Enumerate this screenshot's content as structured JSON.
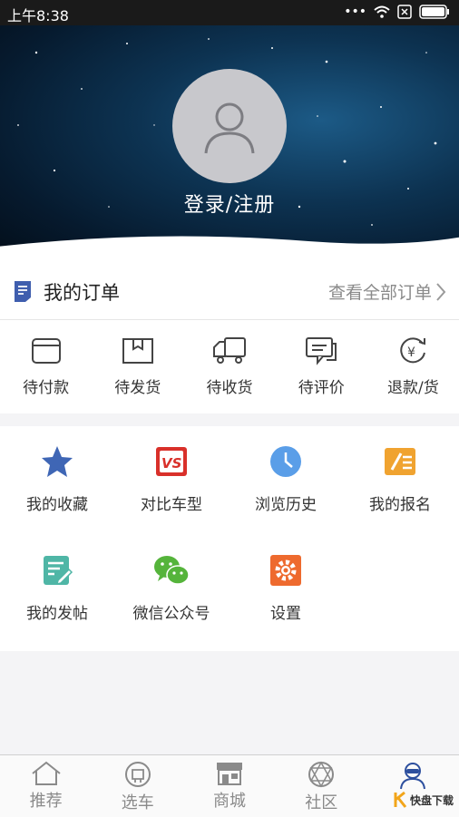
{
  "status_bar": {
    "time": "上午8:38"
  },
  "profile": {
    "login_label": "登录/注册"
  },
  "orders": {
    "title": "我的订单",
    "view_all": "查看全部订单",
    "items": [
      {
        "label": "待付款",
        "icon": "wallet-icon"
      },
      {
        "label": "待发货",
        "icon": "package-icon"
      },
      {
        "label": "待收货",
        "icon": "truck-icon"
      },
      {
        "label": "待评价",
        "icon": "comment-icon"
      },
      {
        "label": "退款/货",
        "icon": "refund-icon"
      }
    ]
  },
  "shortcuts": [
    {
      "label": "我的收藏",
      "icon": "star-icon",
      "color": "#3f66b5"
    },
    {
      "label": "对比车型",
      "icon": "vs-icon",
      "color": "#d9302a"
    },
    {
      "label": "浏览历史",
      "icon": "clock-icon",
      "color": "#5a9ee8"
    },
    {
      "label": "我的报名",
      "icon": "signup-icon",
      "color": "#f0a330"
    },
    {
      "label": "我的发帖",
      "icon": "post-icon",
      "color": "#4fb6a6"
    },
    {
      "label": "微信公众号",
      "icon": "wechat-icon",
      "color": "#55b43b"
    },
    {
      "label": "设置",
      "icon": "settings-icon",
      "color": "#ee6a2e"
    }
  ],
  "tabbar": [
    {
      "label": "推荐",
      "icon": "home-icon"
    },
    {
      "label": "选车",
      "icon": "car-select-icon"
    },
    {
      "label": "商城",
      "icon": "store-icon"
    },
    {
      "label": "社区",
      "icon": "community-icon"
    },
    {
      "label": "",
      "icon": "profile-icon"
    }
  ],
  "watermark": {
    "text": "快盘下载"
  }
}
